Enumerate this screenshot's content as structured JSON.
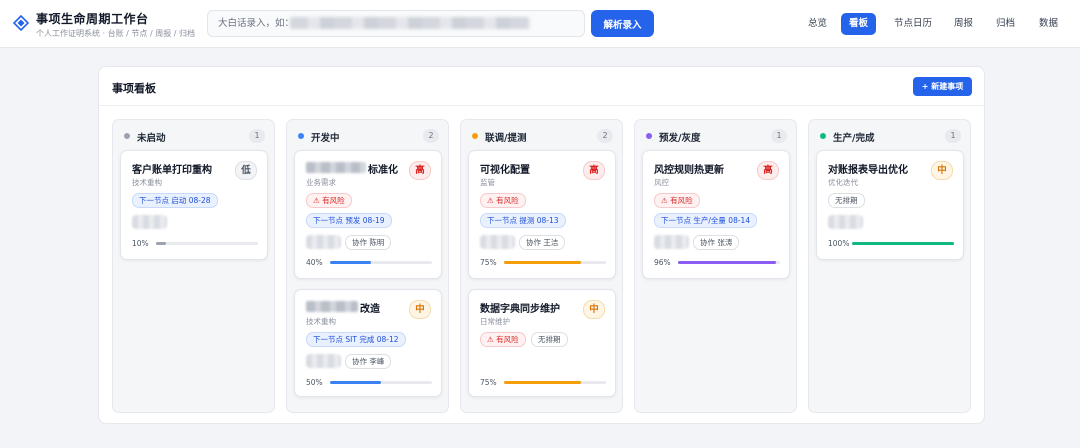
{
  "app": {
    "title": "事项生命周期工作台",
    "subtitle": "个人工作证明系统 · 台账 / 节点 / 周报 / 归档"
  },
  "capture": {
    "placeholder": "大白话录入，如：",
    "parse_label": "解析录入"
  },
  "nav": [
    {
      "label": "总览",
      "active": false
    },
    {
      "label": "看板",
      "active": true
    },
    {
      "label": "节点日历",
      "active": false
    },
    {
      "label": "周报",
      "active": false
    },
    {
      "label": "归档",
      "active": false
    },
    {
      "label": "数据",
      "active": false
    }
  ],
  "board": {
    "title": "事项看板",
    "new_label": "+ 新建事项"
  },
  "colors": {
    "accent": "#2563eb",
    "not_started": "#9ca3af",
    "developing": "#3b82f6",
    "testing": "#f59e0b",
    "pre_release": "#8b5cf6",
    "done": "#10b981"
  },
  "columns": [
    {
      "name": "未启动",
      "count": "1",
      "cards": [
        {
          "title": "客户账单打印重构",
          "category": "技术重构",
          "priority": "低",
          "next": "下一节点 启动 08-28",
          "progress_label": "10%",
          "progress": 0.1
        }
      ]
    },
    {
      "name": "开发中",
      "count": "2",
      "cards": [
        {
          "title": "标准化",
          "category": "业务需求",
          "priority": "高",
          "risk": "⚠ 有风险",
          "next": "下一节点 预发 08-19",
          "collab": "协作 陈明",
          "progress_label": "40%",
          "progress": 0.4
        },
        {
          "title": "改造",
          "category": "技术重构",
          "priority": "中",
          "next": "下一节点 SIT 完成 08-12",
          "collab": "协作 李峰",
          "progress_label": "50%",
          "progress": 0.5
        }
      ]
    },
    {
      "name": "联调/提测",
      "count": "2",
      "cards": [
        {
          "title": "可视化配置",
          "category": "监管",
          "priority": "高",
          "risk": "⚠ 有风险",
          "next": "下一节点 提测 08-13",
          "collab": "协作 王洁",
          "progress_label": "75%",
          "progress": 0.75
        },
        {
          "title": "数据字典同步维护",
          "category": "日常维护",
          "priority": "中",
          "risk": "⚠ 有风险",
          "no_schedule": "无排期",
          "progress_label": "75%",
          "progress": 0.75
        }
      ]
    },
    {
      "name": "预发/灰度",
      "count": "1",
      "cards": [
        {
          "title": "风控规则热更新",
          "category": "风控",
          "priority": "高",
          "risk": "⚠ 有风险",
          "next": "下一节点 生产/全量 08-14",
          "collab": "协作 张涛",
          "progress_label": "96%",
          "progress": 0.96
        }
      ]
    },
    {
      "name": "生产/完成",
      "count": "1",
      "cards": [
        {
          "title": "对账报表导出优化",
          "category": "优化迭代",
          "priority": "中",
          "no_schedule": "无排期",
          "progress_label": "100%",
          "progress": 1.0
        }
      ]
    }
  ]
}
